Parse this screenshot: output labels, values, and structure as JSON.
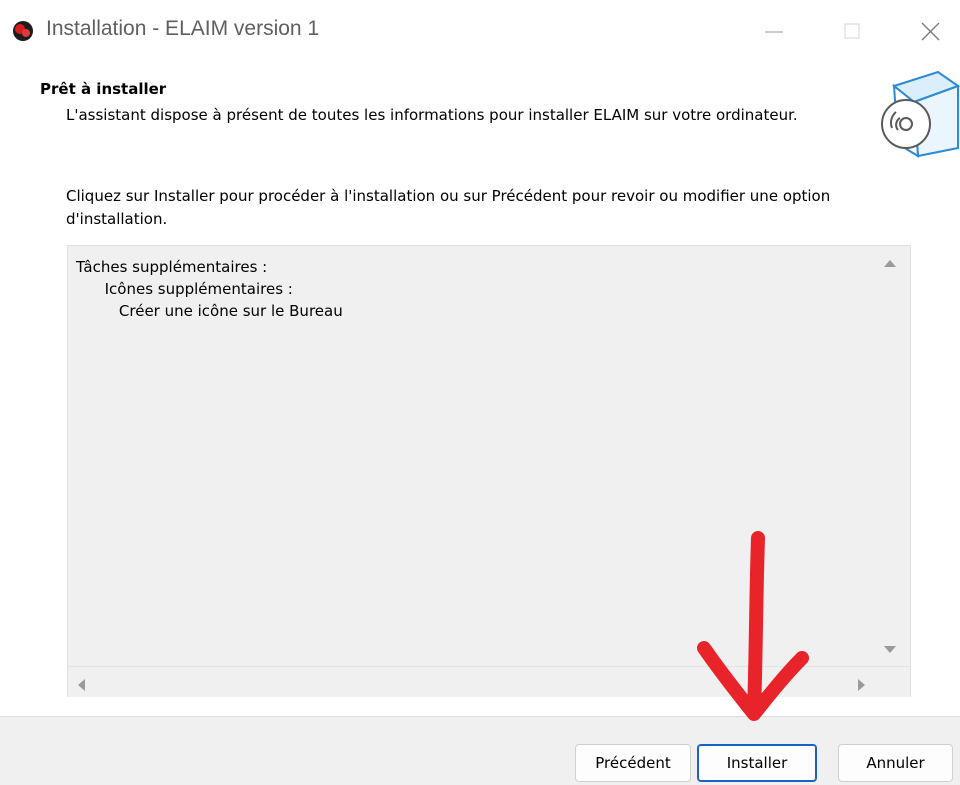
{
  "window": {
    "title": "Installation - ELAIM version 1",
    "app_icon": "elaim-app-icon",
    "controls": [
      "minimize-icon",
      "maximize-icon",
      "close-icon"
    ]
  },
  "header": {
    "heading": "Prêt à installer",
    "subheading": "L'assistant dispose à présent de toutes les informations pour installer ELAIM sur votre ordinateur.",
    "icon": "setup-box-icon"
  },
  "instruction": "Cliquez sur Installer pour procéder à l'installation ou sur Précédent pour revoir ou modifier une option d'installation.",
  "memo": {
    "lines": [
      "Tâches supplémentaires :",
      "      Icônes supplémentaires :",
      "         Créer une icône sur le Bureau"
    ]
  },
  "buttons": {
    "back": "Précédent",
    "install": "Installer",
    "cancel": "Annuler"
  },
  "colors": {
    "accent": "#1a61c4",
    "annotation": "#e8232a",
    "panel": "#f0f0f0"
  }
}
